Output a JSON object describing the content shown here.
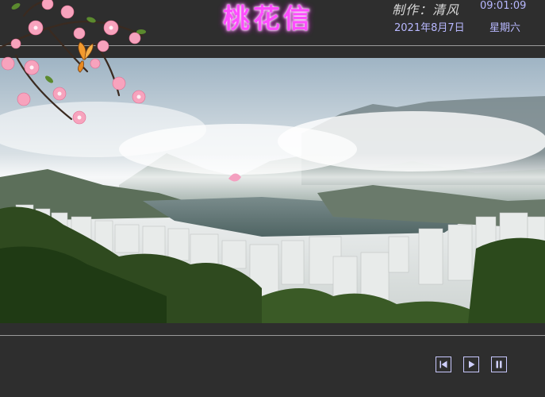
{
  "header": {
    "title": "桃花信",
    "credit": "制作：清风",
    "time": "09:01:09",
    "date": "2021年8月7日",
    "weekday": "星期六"
  },
  "photo": {
    "description_icon": "landscape-photo"
  },
  "controls": {
    "prev_icon": "skip-back-icon",
    "play_icon": "play-icon",
    "pause_icon": "pause-icon"
  },
  "colors": {
    "background": "#2e2e2e",
    "title": "#ff4dff",
    "text": "#b8b8ff",
    "control_border": "#c8c8ff"
  }
}
